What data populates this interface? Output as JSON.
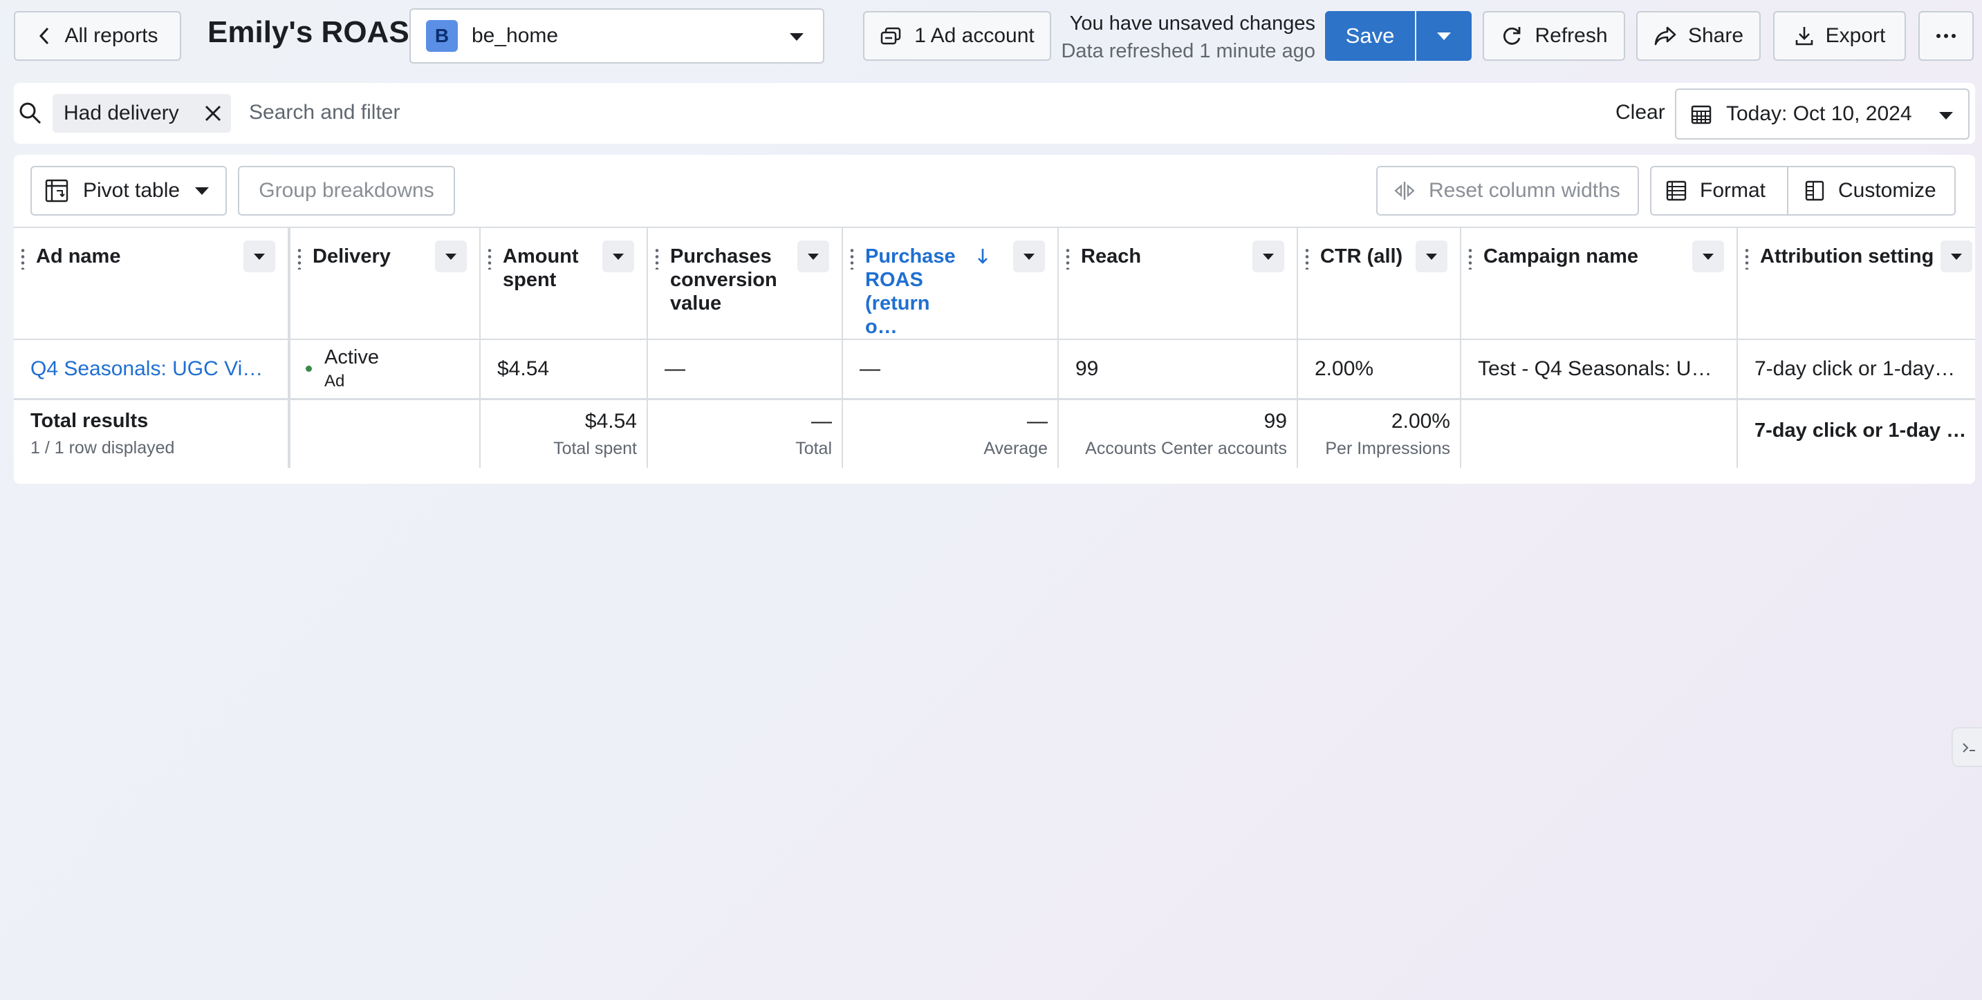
{
  "header": {
    "back_label": "All reports",
    "title": "Emily's ROAS",
    "account": {
      "initial": "B",
      "name": "be_home"
    },
    "ad_account_label": "1 Ad account",
    "unsaved_line": "You have unsaved changes",
    "refreshed_line": "Data refreshed 1 minute ago",
    "save_label": "Save",
    "refresh_label": "Refresh",
    "share_label": "Share",
    "export_label": "Export"
  },
  "filters": {
    "chip_label": "Had delivery",
    "search_placeholder": "Search and filter",
    "clear_label": "Clear",
    "date_label": "Today: Oct 10, 2024"
  },
  "toolbar": {
    "pivot_label": "Pivot table",
    "group_breakdowns_label": "Group breakdowns",
    "reset_widths_label": "Reset column widths",
    "format_label": "Format",
    "customize_label": "Customize"
  },
  "table": {
    "columns": [
      "Ad name",
      "Delivery",
      "Amount spent",
      "Purchases conversion value",
      "Purchase ROAS (return o…",
      "Reach",
      "CTR (all)",
      "Campaign name",
      "Attribution setting"
    ],
    "row": {
      "ad_name": "Q4 Seasonals: UGC Vide…",
      "delivery_status": "Active",
      "delivery_level": "Ad",
      "amount_spent": "$4.54",
      "purchases_value": "—",
      "purchase_roas": "—",
      "reach": "99",
      "ctr": "2.00%",
      "campaign_name": "Test - Q4 Seasonals: UG…",
      "attribution": "7-day click or 1-day vi…"
    },
    "totals": {
      "label": "Total results",
      "rows_displayed": "1 / 1 row displayed",
      "amount_spent": "$4.54",
      "amount_spent_caption": "Total spent",
      "purchases_value": "—",
      "purchases_value_caption": "Total",
      "purchase_roas": "—",
      "purchase_roas_caption": "Average",
      "reach": "99",
      "reach_caption": "Accounts Center accounts",
      "ctr": "2.00%",
      "ctr_caption": "Per Impressions",
      "attribution": "7-day click or 1-day …"
    }
  },
  "colors": {
    "primary": "#2d73c8",
    "link": "#1f6fd1",
    "active_dot": "#3a8a4a"
  }
}
